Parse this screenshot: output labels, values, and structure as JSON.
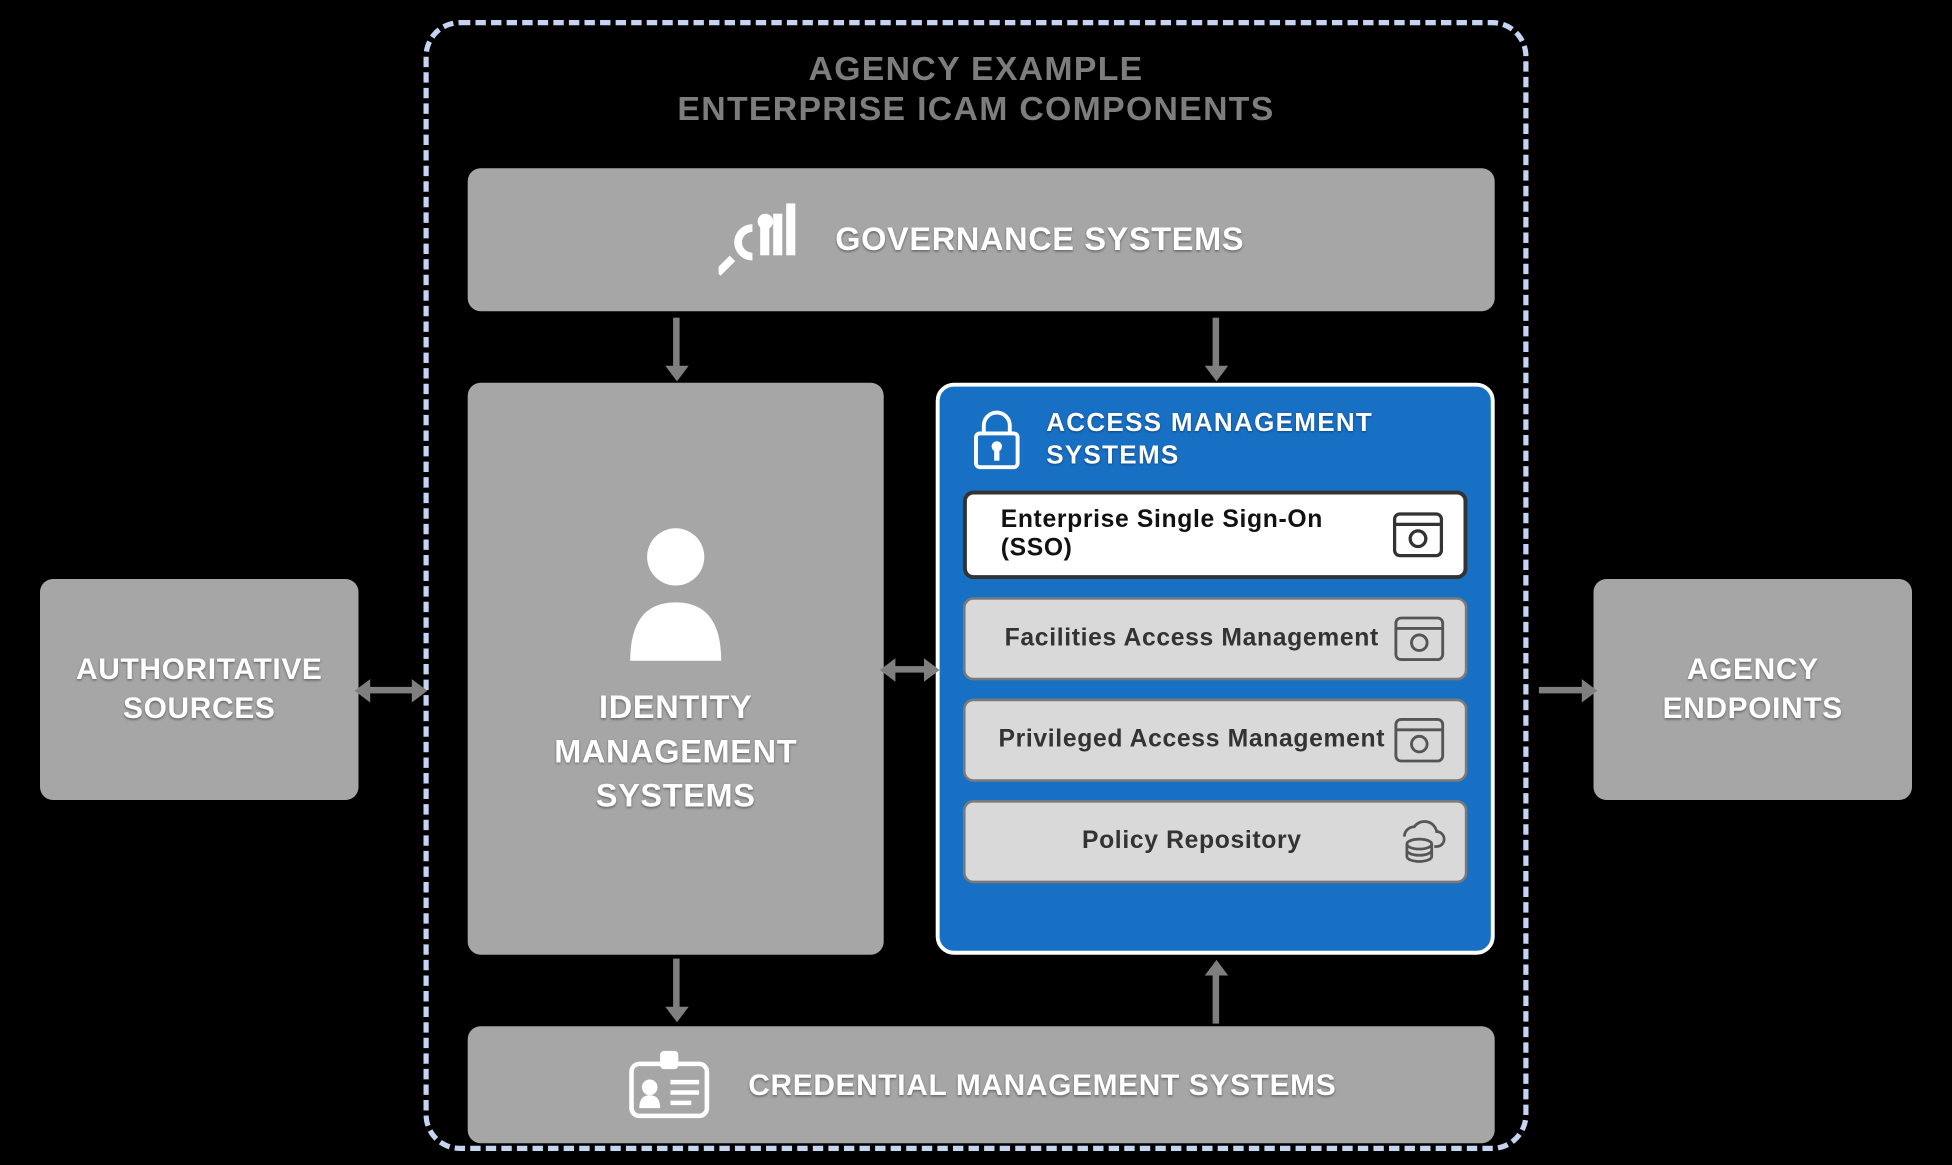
{
  "container": {
    "title_line1": "AGENCY EXAMPLE",
    "title_line2": "ENTERPRISE ICAM COMPONENTS"
  },
  "external": {
    "authoritative": "AUTHORITATIVE SOURCES",
    "endpoints": "AGENCY ENDPOINTS"
  },
  "governance": {
    "title": "GOVERNANCE SYSTEMS"
  },
  "identity": {
    "title": "IDENTITY MANAGEMENT SYSTEMS"
  },
  "credential": {
    "title": "CREDENTIAL MANAGEMENT SYSTEMS"
  },
  "access": {
    "title": "ACCESS MANAGEMENT SYSTEMS",
    "items": [
      {
        "label": "Enterprise Single Sign-On (SSO)",
        "highlight": true,
        "icon": "app"
      },
      {
        "label": "Facilities Access Management",
        "highlight": false,
        "icon": "app"
      },
      {
        "label": "Privileged Access Management",
        "highlight": false,
        "icon": "app"
      },
      {
        "label": "Policy Repository",
        "highlight": false,
        "icon": "cloud-db"
      }
    ]
  }
}
